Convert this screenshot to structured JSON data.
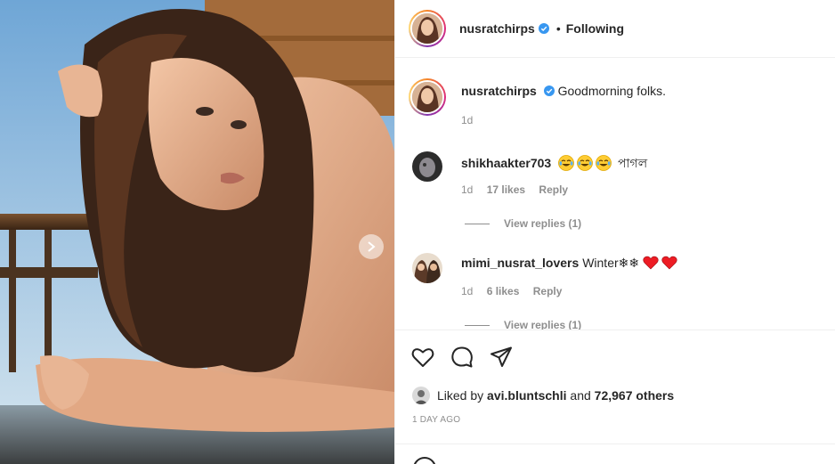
{
  "photo": {
    "alt_subject": "woman with long brown hair resting on arm",
    "next_icon": "chevron-right-icon"
  },
  "header": {
    "username": "nusratchirps",
    "separator": "•",
    "follow_status": "Following",
    "verified_icon": "verified-badge-icon"
  },
  "caption": {
    "username": "nusratchirps",
    "text": "Goodmorning folks.",
    "time": "1d"
  },
  "comments": [
    {
      "username": "shikhaakter703",
      "text": "পাগল",
      "emojis": [
        "laughing-tears-emoji",
        "laughing-tears-emoji",
        "laughing-tears-emoji"
      ],
      "time": "1d",
      "likes": "17 likes",
      "reply_label": "Reply",
      "view_replies": "View replies (1)"
    },
    {
      "username": "mimi_nusrat_lovers",
      "text": "Winter❄❄",
      "emojis": [
        "red-heart-emoji",
        "red-heart-emoji"
      ],
      "time": "1d",
      "likes": "6 likes",
      "reply_label": "Reply",
      "view_replies": "View replies (1)"
    }
  ],
  "actions": {
    "like_icon": "heart-icon",
    "comment_icon": "comment-icon",
    "share_icon": "share-icon"
  },
  "likes": {
    "prefix": "Liked by",
    "liker": "avi.bluntschli",
    "middle": "and",
    "others": "72,967 others"
  },
  "post_date": "1 DAY AGO",
  "colors": {
    "verified": "#3897f0",
    "secondary_text": "#8e8e8e",
    "primary_text": "#262626",
    "border": "#efefef",
    "heart_red": "#ed1c24"
  }
}
